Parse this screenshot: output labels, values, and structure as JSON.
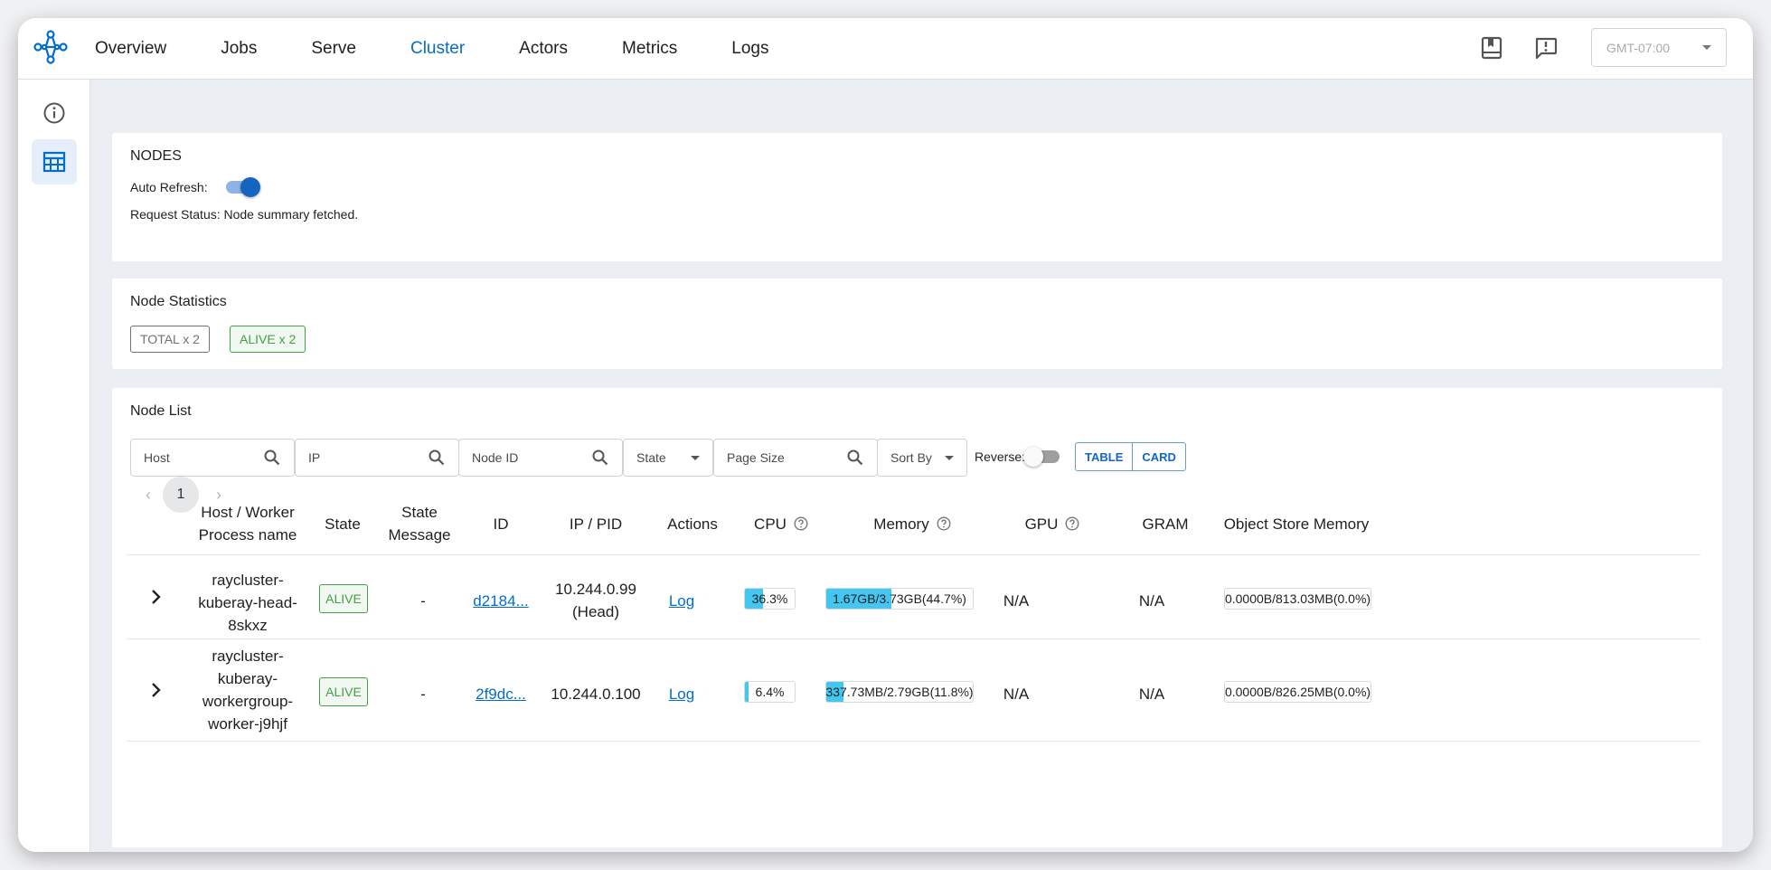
{
  "nav": {
    "items": [
      {
        "label": "Overview",
        "active": false
      },
      {
        "label": "Jobs",
        "active": false
      },
      {
        "label": "Serve",
        "active": false
      },
      {
        "label": "Cluster",
        "active": true
      },
      {
        "label": "Actors",
        "active": false
      },
      {
        "label": "Metrics",
        "active": false
      },
      {
        "label": "Logs",
        "active": false
      }
    ],
    "timezone": "GMT-07:00",
    "icons": [
      "docs-book-icon",
      "feedback-icon"
    ]
  },
  "sidebar": {
    "items": [
      {
        "icon": "info-icon",
        "active": false
      },
      {
        "icon": "table-icon",
        "active": true
      }
    ]
  },
  "nodes_panel": {
    "title": "NODES",
    "auto_refresh_label": "Auto Refresh:",
    "auto_refresh_on": true,
    "request_status": "Request Status: Node summary fetched."
  },
  "stats_panel": {
    "title": "Node Statistics",
    "chips": [
      "TOTAL x 2",
      "ALIVE x 2"
    ]
  },
  "list_panel": {
    "title": "Node List",
    "filters": {
      "host": "Host",
      "ip": "IP",
      "node_id": "Node ID",
      "state": "State",
      "page_size": "Page Size",
      "sort_by": "Sort By"
    },
    "reverse_label": "Reverse:",
    "reverse_on": false,
    "view_toggle": [
      "TABLE",
      "CARD"
    ],
    "pager": {
      "current": "1",
      "prev": "‹",
      "next": "›"
    },
    "columns": [
      "Host / Worker Process name",
      "State",
      "State Message",
      "ID",
      "IP / PID",
      "Actions",
      "CPU",
      "Memory",
      "GPU",
      "GRAM",
      "Object Store Memory"
    ],
    "rows": [
      {
        "host": "raycluster-kuberay-head-8skxz",
        "state": "ALIVE",
        "state_message": "-",
        "id": "d2184...",
        "ip": "10.244.0.99 (Head)",
        "action": "Log",
        "cpu": "36.3%",
        "cpu_pct": 36.3,
        "memory": "1.67GB/3.73GB(44.7%)",
        "memory_pct": 44.7,
        "gpu": "N/A",
        "gram": "N/A",
        "object_store": "0.0000B/813.03MB(0.0%)",
        "object_store_pct": 0
      },
      {
        "host": "raycluster-kuberay-workergroup-worker-j9hjf",
        "state": "ALIVE",
        "state_message": "-",
        "id": "2f9dc...",
        "ip": "10.244.0.100",
        "action": "Log",
        "cpu": "6.4%",
        "cpu_pct": 6.4,
        "memory": "337.73MB/2.79GB(11.8%)",
        "memory_pct": 11.8,
        "gpu": "N/A",
        "gram": "N/A",
        "object_store": "0.0000B/826.25MB(0.0%)",
        "object_store_pct": 0
      }
    ]
  },
  "colors": {
    "accent": "#036dcf",
    "alive": "#43a047",
    "bar_fill": "#43c6ef",
    "content_bg": "#ebeef2"
  }
}
